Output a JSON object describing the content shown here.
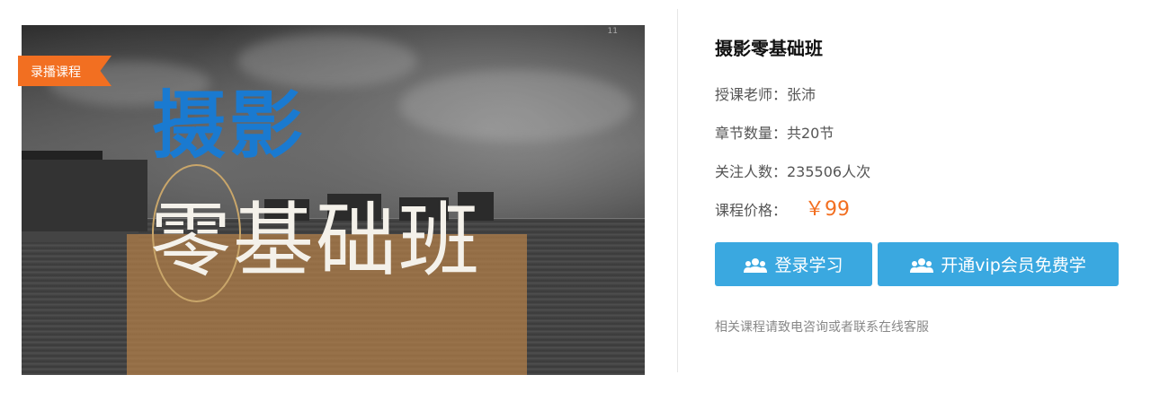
{
  "course_cover": {
    "badge": "录播课程",
    "headline_top": "摄影",
    "headline_bottom": "零基础班",
    "corner_mark": "11"
  },
  "course_info": {
    "title": "摄影零基础班",
    "teacher": "授课老师：张沛",
    "chapters": "章节数量：共20节",
    "followers": "关注人数：235506人次",
    "price_label": "课程价格：",
    "price": "￥99"
  },
  "actions": {
    "login_label": "登录学习",
    "vip_label": "开通vip会员免费学"
  },
  "footer_note": "相关课程请致电咨询或者联系在线客服",
  "colors": {
    "accent_orange": "#f26f21",
    "button_blue": "#3aa8e0",
    "title_blue": "#1a7ad0"
  },
  "icons": [
    "users-icon"
  ]
}
